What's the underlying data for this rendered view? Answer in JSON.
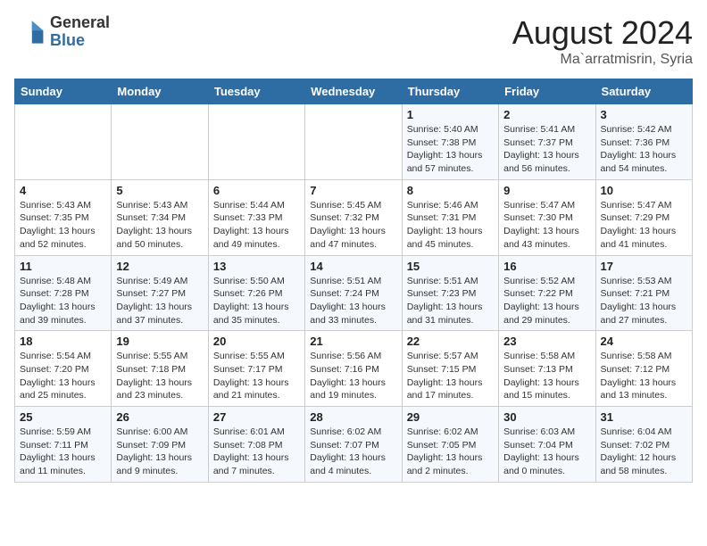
{
  "header": {
    "logo_general": "General",
    "logo_blue": "Blue",
    "title": "August 2024",
    "location": "Ma`arratmisrin, Syria"
  },
  "weekdays": [
    "Sunday",
    "Monday",
    "Tuesday",
    "Wednesday",
    "Thursday",
    "Friday",
    "Saturday"
  ],
  "weeks": [
    [
      {
        "day": "",
        "detail": ""
      },
      {
        "day": "",
        "detail": ""
      },
      {
        "day": "",
        "detail": ""
      },
      {
        "day": "",
        "detail": ""
      },
      {
        "day": "1",
        "detail": "Sunrise: 5:40 AM\nSunset: 7:38 PM\nDaylight: 13 hours\nand 57 minutes."
      },
      {
        "day": "2",
        "detail": "Sunrise: 5:41 AM\nSunset: 7:37 PM\nDaylight: 13 hours\nand 56 minutes."
      },
      {
        "day": "3",
        "detail": "Sunrise: 5:42 AM\nSunset: 7:36 PM\nDaylight: 13 hours\nand 54 minutes."
      }
    ],
    [
      {
        "day": "4",
        "detail": "Sunrise: 5:43 AM\nSunset: 7:35 PM\nDaylight: 13 hours\nand 52 minutes."
      },
      {
        "day": "5",
        "detail": "Sunrise: 5:43 AM\nSunset: 7:34 PM\nDaylight: 13 hours\nand 50 minutes."
      },
      {
        "day": "6",
        "detail": "Sunrise: 5:44 AM\nSunset: 7:33 PM\nDaylight: 13 hours\nand 49 minutes."
      },
      {
        "day": "7",
        "detail": "Sunrise: 5:45 AM\nSunset: 7:32 PM\nDaylight: 13 hours\nand 47 minutes."
      },
      {
        "day": "8",
        "detail": "Sunrise: 5:46 AM\nSunset: 7:31 PM\nDaylight: 13 hours\nand 45 minutes."
      },
      {
        "day": "9",
        "detail": "Sunrise: 5:47 AM\nSunset: 7:30 PM\nDaylight: 13 hours\nand 43 minutes."
      },
      {
        "day": "10",
        "detail": "Sunrise: 5:47 AM\nSunset: 7:29 PM\nDaylight: 13 hours\nand 41 minutes."
      }
    ],
    [
      {
        "day": "11",
        "detail": "Sunrise: 5:48 AM\nSunset: 7:28 PM\nDaylight: 13 hours\nand 39 minutes."
      },
      {
        "day": "12",
        "detail": "Sunrise: 5:49 AM\nSunset: 7:27 PM\nDaylight: 13 hours\nand 37 minutes."
      },
      {
        "day": "13",
        "detail": "Sunrise: 5:50 AM\nSunset: 7:26 PM\nDaylight: 13 hours\nand 35 minutes."
      },
      {
        "day": "14",
        "detail": "Sunrise: 5:51 AM\nSunset: 7:24 PM\nDaylight: 13 hours\nand 33 minutes."
      },
      {
        "day": "15",
        "detail": "Sunrise: 5:51 AM\nSunset: 7:23 PM\nDaylight: 13 hours\nand 31 minutes."
      },
      {
        "day": "16",
        "detail": "Sunrise: 5:52 AM\nSunset: 7:22 PM\nDaylight: 13 hours\nand 29 minutes."
      },
      {
        "day": "17",
        "detail": "Sunrise: 5:53 AM\nSunset: 7:21 PM\nDaylight: 13 hours\nand 27 minutes."
      }
    ],
    [
      {
        "day": "18",
        "detail": "Sunrise: 5:54 AM\nSunset: 7:20 PM\nDaylight: 13 hours\nand 25 minutes."
      },
      {
        "day": "19",
        "detail": "Sunrise: 5:55 AM\nSunset: 7:18 PM\nDaylight: 13 hours\nand 23 minutes."
      },
      {
        "day": "20",
        "detail": "Sunrise: 5:55 AM\nSunset: 7:17 PM\nDaylight: 13 hours\nand 21 minutes."
      },
      {
        "day": "21",
        "detail": "Sunrise: 5:56 AM\nSunset: 7:16 PM\nDaylight: 13 hours\nand 19 minutes."
      },
      {
        "day": "22",
        "detail": "Sunrise: 5:57 AM\nSunset: 7:15 PM\nDaylight: 13 hours\nand 17 minutes."
      },
      {
        "day": "23",
        "detail": "Sunrise: 5:58 AM\nSunset: 7:13 PM\nDaylight: 13 hours\nand 15 minutes."
      },
      {
        "day": "24",
        "detail": "Sunrise: 5:58 AM\nSunset: 7:12 PM\nDaylight: 13 hours\nand 13 minutes."
      }
    ],
    [
      {
        "day": "25",
        "detail": "Sunrise: 5:59 AM\nSunset: 7:11 PM\nDaylight: 13 hours\nand 11 minutes."
      },
      {
        "day": "26",
        "detail": "Sunrise: 6:00 AM\nSunset: 7:09 PM\nDaylight: 13 hours\nand 9 minutes."
      },
      {
        "day": "27",
        "detail": "Sunrise: 6:01 AM\nSunset: 7:08 PM\nDaylight: 13 hours\nand 7 minutes."
      },
      {
        "day": "28",
        "detail": "Sunrise: 6:02 AM\nSunset: 7:07 PM\nDaylight: 13 hours\nand 4 minutes."
      },
      {
        "day": "29",
        "detail": "Sunrise: 6:02 AM\nSunset: 7:05 PM\nDaylight: 13 hours\nand 2 minutes."
      },
      {
        "day": "30",
        "detail": "Sunrise: 6:03 AM\nSunset: 7:04 PM\nDaylight: 13 hours\nand 0 minutes."
      },
      {
        "day": "31",
        "detail": "Sunrise: 6:04 AM\nSunset: 7:02 PM\nDaylight: 12 hours\nand 58 minutes."
      }
    ]
  ]
}
